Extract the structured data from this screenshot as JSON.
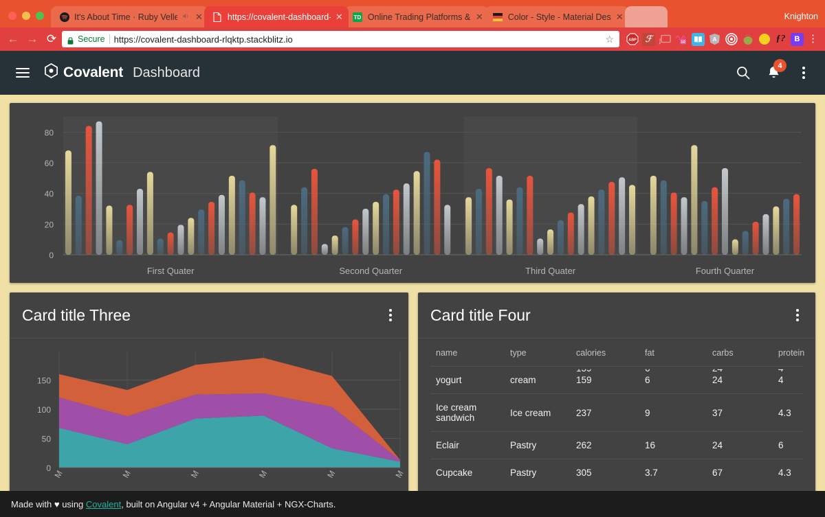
{
  "browser": {
    "profile_name": "Knighton",
    "tabs": [
      {
        "title": "It's About Time · Ruby Velle",
        "favicon": "spotify-icon",
        "audio": true,
        "active": false
      },
      {
        "title": "https://covalent-dashboard-rlq",
        "favicon": "document-icon",
        "audio": false,
        "active": true
      },
      {
        "title": "Online Trading Platforms & Too",
        "favicon": "td-icon",
        "audio": false,
        "active": false
      },
      {
        "title": "Color - Style - Material Design",
        "favicon": "material-icon",
        "audio": false,
        "active": false
      }
    ],
    "close_glyph": "✕",
    "audio_glyph": "◂))",
    "nav": {
      "back": "←",
      "forward": "→",
      "reload": "⟳"
    },
    "omnibox": {
      "secure_label": "Secure",
      "url": "https://covalent-dashboard-rlqktp.stackblitz.io",
      "star": "☆",
      "lock_icon": "lock-icon"
    },
    "extensions": [
      {
        "name": "adblock-plus-icon",
        "label": "ABP",
        "bg": "#c92a2a",
        "fg": "#ffffff"
      },
      {
        "name": "json-formatter-icon",
        "label": "ℱ",
        "bg": "#c0453a",
        "fg": "#f3d8d4"
      },
      {
        "name": "cast-icon",
        "label": "▭",
        "bg": "#e04040",
        "fg": "#f09a95"
      },
      {
        "name": "momentum-10-icon",
        "label": "10",
        "bg": "#ef4d8a",
        "fg": "#ffffff"
      },
      {
        "name": "dictionary-icon",
        "label": "📖",
        "bg": "#3fb6e8",
        "fg": "#ffffff"
      },
      {
        "name": "angular-augury-icon",
        "label": "A",
        "bg": "#b8b8b8",
        "fg": "#ffffff"
      },
      {
        "name": "target-icon",
        "label": "◎",
        "bg": "#e04040",
        "fg": "#ffffff"
      },
      {
        "name": "tomato-timer-icon",
        "label": "●",
        "bg": "#e04040",
        "fg": "#9aa84a"
      },
      {
        "name": "night-mode-icon",
        "label": "☾",
        "bg": "#f5d020",
        "fg": "#3a2d8a"
      },
      {
        "name": "f-question-icon",
        "label": "ƒ?",
        "bg": "#e04040",
        "fg": "#1a1a1a"
      },
      {
        "name": "bootstrap-icon",
        "label": "B",
        "bg": "#7a3cf0",
        "fg": "#ffffff"
      }
    ],
    "chrome_menu_glyph": "⋮"
  },
  "app": {
    "brand": "Covalent",
    "title": "Dashboard",
    "notification_count": "4",
    "search_icon": "search-icon",
    "bell_icon": "notifications-bell-icon",
    "menu_icon": "more-vert-icon",
    "hamburger_icon": "hamburger-menu-icon",
    "logo_icon": "covalent-hex-logo-icon"
  },
  "cards": {
    "three": {
      "title": "Card title Three",
      "menu_icon": "more-vert-icon"
    },
    "four": {
      "title": "Card title Four",
      "menu_icon": "more-vert-icon"
    }
  },
  "table": {
    "columns": [
      "name",
      "type",
      "calories",
      "fat",
      "carbs",
      "protein"
    ],
    "rows": [
      {
        "name": "yogurt",
        "type": "cream",
        "calories": "159",
        "fat": "6",
        "carbs": "24",
        "protein": "4",
        "clipped": true
      },
      {
        "name": "Ice cream sandwich",
        "type": "Ice cream",
        "calories": "237",
        "fat": "9",
        "carbs": "37",
        "protein": "4.3",
        "clipped": false
      },
      {
        "name": "Eclair",
        "type": "Pastry",
        "calories": "262",
        "fat": "16",
        "carbs": "24",
        "protein": "6",
        "clipped": false
      },
      {
        "name": "Cupcake",
        "type": "Pastry",
        "calories": "305",
        "fat": "3.7",
        "carbs": "67",
        "protein": "4.3",
        "clipped": false
      }
    ]
  },
  "footer": {
    "prefix": "Made with ",
    "heart": "♥",
    "middle": " using ",
    "link": "Covalent",
    "suffix": ", built on Angular v4 + Angular Material + NGX-Charts."
  },
  "chart_data": [
    {
      "id": "bar-chart",
      "type": "bar",
      "title": "",
      "xlabel": "",
      "ylabel": "",
      "ylim": [
        0,
        90
      ],
      "yticks": [
        0,
        20,
        40,
        60,
        80
      ],
      "grid": true,
      "legend": false,
      "group_labels": [
        "First Quater",
        "Second Quarter",
        "Third Quater",
        "Fourth Quarter"
      ],
      "series_colors": [
        "#e5d89b",
        "#4c6b80",
        "#e8553d",
        "#c3c8cc"
      ],
      "series_names": [
        "series-a",
        "series-b",
        "series-c",
        "series-d"
      ],
      "groups": [
        {
          "label": "First Quater",
          "values": [
            68,
            38.5,
            84,
            87,
            32,
            9.5,
            32.5,
            43,
            54,
            10.5,
            14.5,
            19.5,
            24,
            29.5,
            34.5,
            39,
            51.5,
            48.5,
            40.5,
            37.5,
            71.5
          ]
        },
        {
          "label": "Second Quarter",
          "values": [
            32.5,
            44,
            56,
            7,
            12.5,
            18,
            23,
            30,
            34.5,
            39.5,
            42.5,
            46.5,
            54.5,
            67,
            62,
            32.5
          ]
        },
        {
          "label": "Third Quater",
          "values": [
            37.5,
            43,
            56.5,
            51.5,
            36,
            44,
            51.5,
            10.5,
            16.5,
            22.5,
            27.5,
            33,
            38,
            42.5,
            47.5,
            50.5,
            45.5
          ]
        },
        {
          "label": "Fourth Quarter",
          "values": [
            51.5,
            48.5,
            40.5,
            37.5,
            71.5,
            35,
            44,
            56.5,
            10,
            15.5,
            21.5,
            26.5,
            31.5,
            36.5,
            39.5
          ]
        }
      ]
    },
    {
      "id": "area-chart",
      "type": "area",
      "stacked": true,
      "title": "Card title Three",
      "xlabel": "",
      "ylabel": "",
      "ylim": [
        0,
        200
      ],
      "yticks": [
        0,
        50,
        100,
        150
      ],
      "grid": true,
      "legend": false,
      "x": [
        "M",
        "M",
        "M",
        "M",
        "M",
        "M"
      ],
      "series": [
        {
          "name": "series-1",
          "color": "#3da5aa",
          "values": [
            68,
            40,
            84,
            89,
            33,
            10
          ]
        },
        {
          "name": "series-2",
          "color": "#a04fa8",
          "values": [
            52,
            48,
            41,
            38,
            71,
            3
          ]
        },
        {
          "name": "series-3",
          "color": "#d2603a",
          "values": [
            40,
            45,
            51,
            61,
            53,
            0
          ]
        }
      ]
    }
  ]
}
